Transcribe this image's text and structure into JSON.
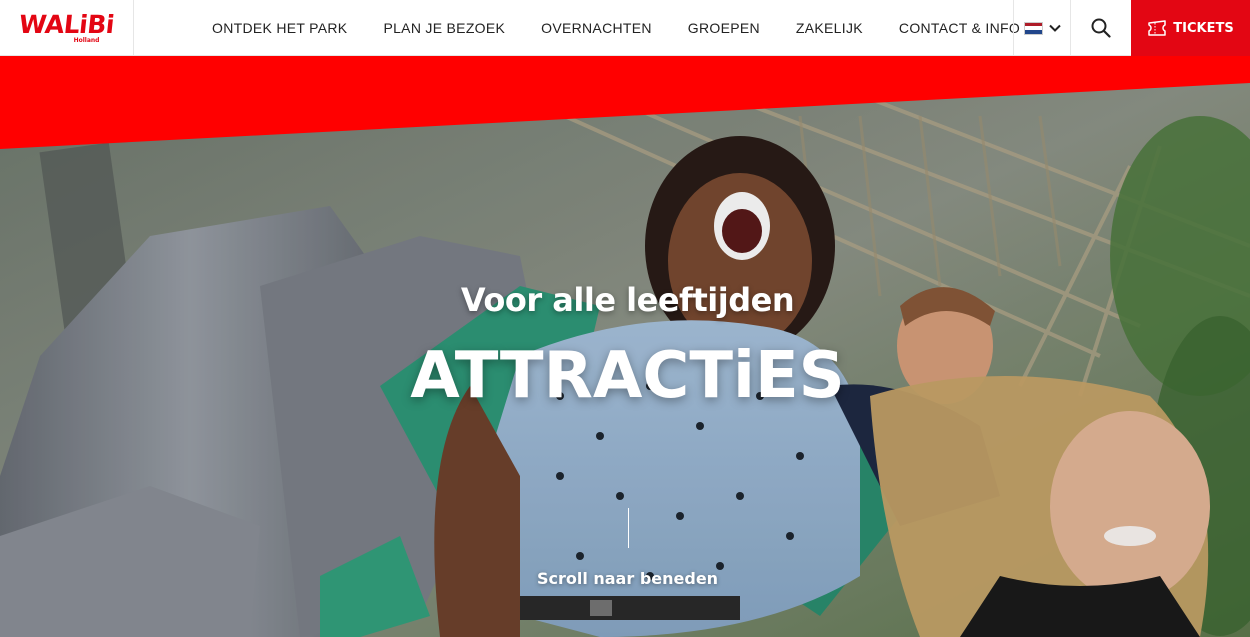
{
  "header": {
    "logo_text": "WALiBi",
    "logo_subtext": "Holland",
    "nav": [
      {
        "label": "ONTDEK HET PARK"
      },
      {
        "label": "PLAN JE BEZOEK"
      },
      {
        "label": "OVERNACHTEN"
      },
      {
        "label": "GROEPEN"
      },
      {
        "label": "ZAKELIJK"
      },
      {
        "label": "CONTACT & INFO"
      }
    ],
    "language_icon": "dutch-flag-icon",
    "search_icon": "search-icon",
    "tickets_label": "TICKETS",
    "tickets_icon": "ticket-icon"
  },
  "hero": {
    "kicker": "Voor alle leeftijden",
    "title": "ATTRACTiES",
    "scroll_label": "Scroll naar beneden"
  },
  "colors": {
    "brand_red": "#e30613",
    "hero_text": "#ffffff"
  }
}
